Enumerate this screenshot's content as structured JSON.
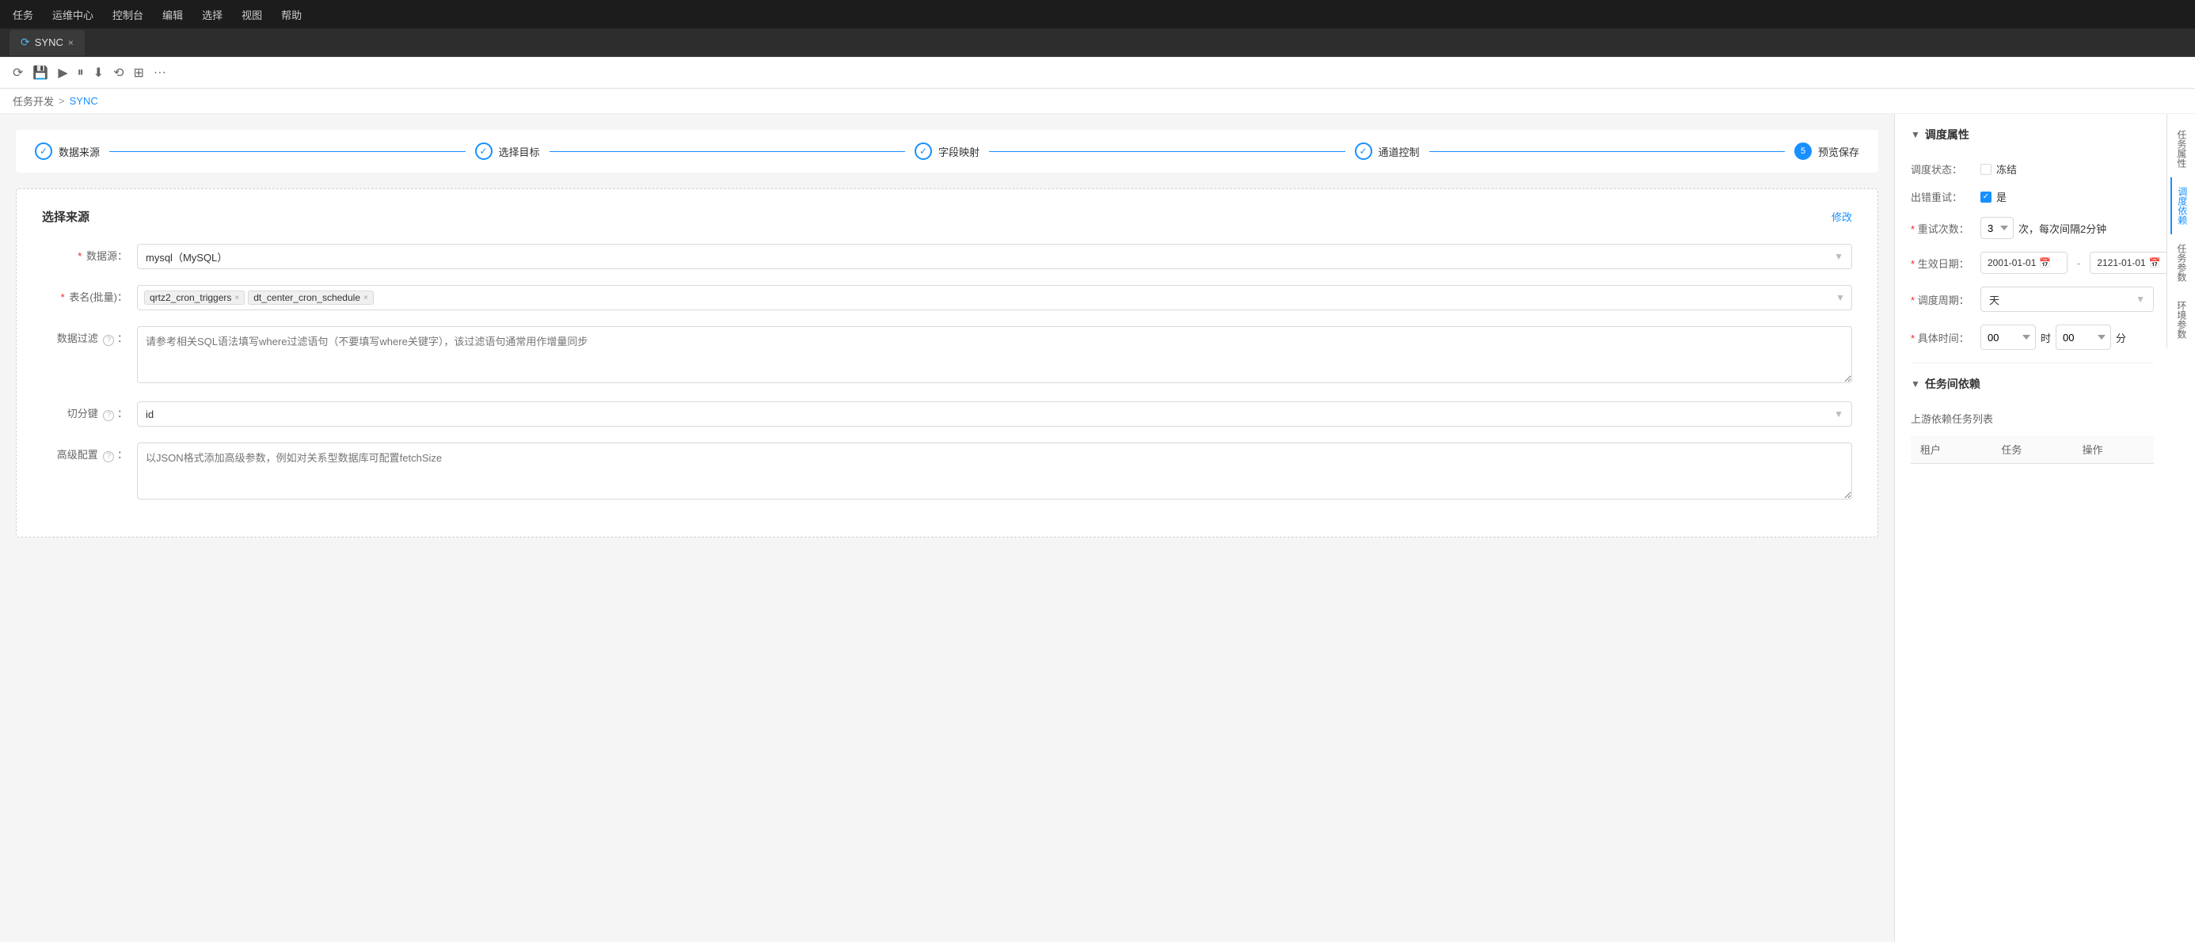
{
  "menu": {
    "items": [
      "任务",
      "运维中心",
      "控制台",
      "编辑",
      "选择",
      "视图",
      "帮助"
    ]
  },
  "tab": {
    "icon": "⟳",
    "title": "SYNC",
    "close": "×"
  },
  "toolbar": {
    "icons": [
      "⟳",
      "💾",
      "▶",
      "⏸",
      "⬇",
      "⟲",
      "⊞",
      "···"
    ]
  },
  "breadcrumb": {
    "parent": "任务开发",
    "sep": ">",
    "current": "SYNC"
  },
  "steps": [
    {
      "id": 1,
      "label": "数据来源",
      "status": "done"
    },
    {
      "id": 2,
      "label": "选择目标",
      "status": "done"
    },
    {
      "id": 3,
      "label": "字段映射",
      "status": "done"
    },
    {
      "id": 4,
      "label": "通道控制",
      "status": "done"
    },
    {
      "id": 5,
      "label": "预览保存",
      "status": "active"
    }
  ],
  "form": {
    "title": "选择来源",
    "modify_btn": "修改",
    "datasource_label": "数据源：",
    "datasource_value": "mysql（MySQL）",
    "table_label": "表名(批量)：",
    "table_tags": [
      "qrtz2_cron_triggers",
      "dt_center_cron_schedule"
    ],
    "filter_label": "数据过滤",
    "filter_placeholder": "请参考相关SQL语法填写where过滤语句（不要填写where关键字），该过滤语句通常用作增量同步",
    "split_label": "切分键",
    "split_value": "id",
    "advanced_label": "高级配置",
    "advanced_placeholder": "以JSON格式添加高级参数，例如对关系型数据库可配置fetchSize"
  },
  "right_panel": {
    "schedule_section": "调度属性",
    "status_label": "调度状态：",
    "freeze_label": "冻结",
    "retry_label": "出错重试：",
    "retry_checked": true,
    "retry_yes": "是",
    "retries_label": "重试次数：",
    "retries_value": "3",
    "retries_suffix": "次，每次间隔2分钟",
    "effective_label": "生效日期：",
    "date_start": "2001-01-01",
    "date_end": "2121-01-01",
    "period_label": "调度周期：",
    "period_value": "天",
    "time_label": "具体时间：",
    "time_hour": "00",
    "time_min": "00",
    "time_hour_unit": "时",
    "time_min_unit": "分",
    "depend_section": "任务间依赖",
    "upstream_label": "上游依赖任务列表",
    "table_cols": [
      "租户",
      "任务",
      "操作"
    ]
  },
  "far_right_tabs": [
    {
      "label": "任务属性",
      "active": false
    },
    {
      "label": "调度依赖",
      "active": true
    },
    {
      "label": "任务参数",
      "active": false
    },
    {
      "label": "环境参数",
      "active": false
    }
  ]
}
